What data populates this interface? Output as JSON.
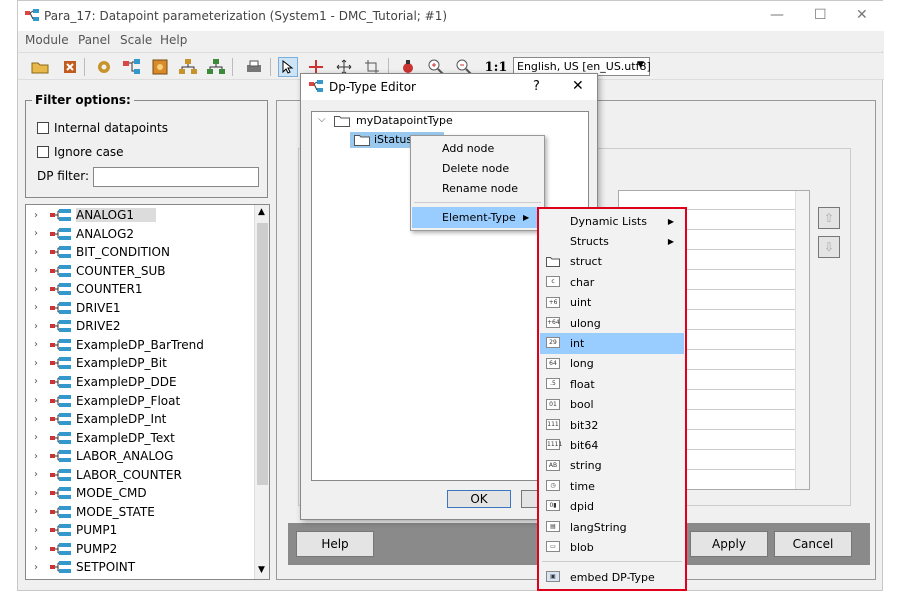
{
  "window": {
    "title": "Para_17: Datapoint parameterization (System1 - DMC_Tutorial; #1)"
  },
  "menubar": [
    "Module",
    "Panel",
    "Scale",
    "Help"
  ],
  "toolbar": {
    "zoom_label": "1:1",
    "language": "English, US [en_US.utf8]"
  },
  "filter": {
    "title": "Filter options:",
    "internal_label": "Internal datapoints",
    "ignore_case_label": "Ignore case",
    "dp_filter_label": "DP filter:",
    "dp_filter_value": ""
  },
  "datapoints": [
    "ANALOG1",
    "ANALOG2",
    "BIT_CONDITION",
    "COUNTER_SUB",
    "COUNTER1",
    "DRIVE1",
    "DRIVE2",
    "ExampleDP_BarTrend",
    "ExampleDP_Bit",
    "ExampleDP_DDE",
    "ExampleDP_Float",
    "ExampleDP_Int",
    "ExampleDP_Text",
    "LABOR_ANALOG",
    "LABOR_COUNTER",
    "MODE_CMD",
    "MODE_STATE",
    "PUMP1",
    "PUMP2",
    "SETPOINT"
  ],
  "bottom_buttons": {
    "help": "Help",
    "apply": "Apply",
    "cancel": "Cancel"
  },
  "dialog": {
    "title": "Dp-Type Editor",
    "help_glyph": "?",
    "close_glyph": "✕",
    "root_node": "myDatapointType",
    "child_node": "iStatus",
    "ok": "OK"
  },
  "context_menu": {
    "add": "Add node",
    "delete": "Delete node",
    "rename": "Rename node",
    "element_type": "Element-Type"
  },
  "element_menu": {
    "items": [
      {
        "label": "Dynamic Lists",
        "icon": "",
        "submenu": true
      },
      {
        "label": "Structs",
        "icon": "",
        "submenu": true
      },
      {
        "label": "struct",
        "icon": "folder",
        "submenu": false
      },
      {
        "label": "char",
        "icon": "char",
        "submenu": false
      },
      {
        "label": "uint",
        "icon": "uint",
        "submenu": false
      },
      {
        "label": "ulong",
        "icon": "ulong",
        "submenu": false
      },
      {
        "label": "int",
        "icon": "int",
        "submenu": false
      },
      {
        "label": "long",
        "icon": "long",
        "submenu": false
      },
      {
        "label": "float",
        "icon": "float",
        "submenu": false
      },
      {
        "label": "bool",
        "icon": "bool",
        "submenu": false
      },
      {
        "label": "bit32",
        "icon": "bit32",
        "submenu": false
      },
      {
        "label": "bit64",
        "icon": "bit64",
        "submenu": false
      },
      {
        "label": "string",
        "icon": "string",
        "submenu": false
      },
      {
        "label": "time",
        "icon": "time",
        "submenu": false
      },
      {
        "label": "dpid",
        "icon": "dpid",
        "submenu": false
      },
      {
        "label": "langString",
        "icon": "langString",
        "submenu": false
      },
      {
        "label": "blob",
        "icon": "blob",
        "submenu": false
      }
    ],
    "embed": "embed DP-Type",
    "highlight_color": "#99ccff",
    "frame_color": "#e0001b"
  }
}
